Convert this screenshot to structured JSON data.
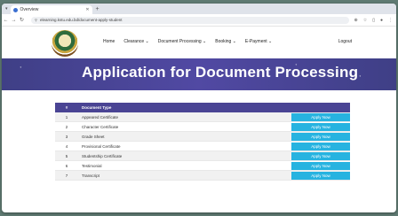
{
  "browser": {
    "tab_title": "Overview",
    "url": "elearning.kstu.edu.bd/document-apply-student"
  },
  "nav": {
    "items": [
      "Home",
      "Clearance",
      "Document Processing",
      "Booking",
      "E-Payment"
    ],
    "logout": "Logout"
  },
  "banner": {
    "title": "Application for Document Processing"
  },
  "table": {
    "headers": [
      "#",
      "Document Type",
      ""
    ],
    "rows": [
      {
        "sn": "1",
        "type": "Appeared Certificate",
        "action": "Apply Now"
      },
      {
        "sn": "2",
        "type": "Character Certificate",
        "action": "Apply Now"
      },
      {
        "sn": "3",
        "type": "Grade Sheet",
        "action": "Apply Now"
      },
      {
        "sn": "4",
        "type": "Provisional Certificate",
        "action": "Apply Now"
      },
      {
        "sn": "5",
        "type": "Studentship Certificate",
        "action": "Apply Now"
      },
      {
        "sn": "6",
        "type": "Testimonial",
        "action": "Apply Now"
      },
      {
        "sn": "7",
        "type": "Transcript",
        "action": "Apply Now"
      }
    ]
  },
  "colors": {
    "banner": "#4b4499",
    "header_row": "#4a4494",
    "apply_button": "#27b3e0"
  }
}
